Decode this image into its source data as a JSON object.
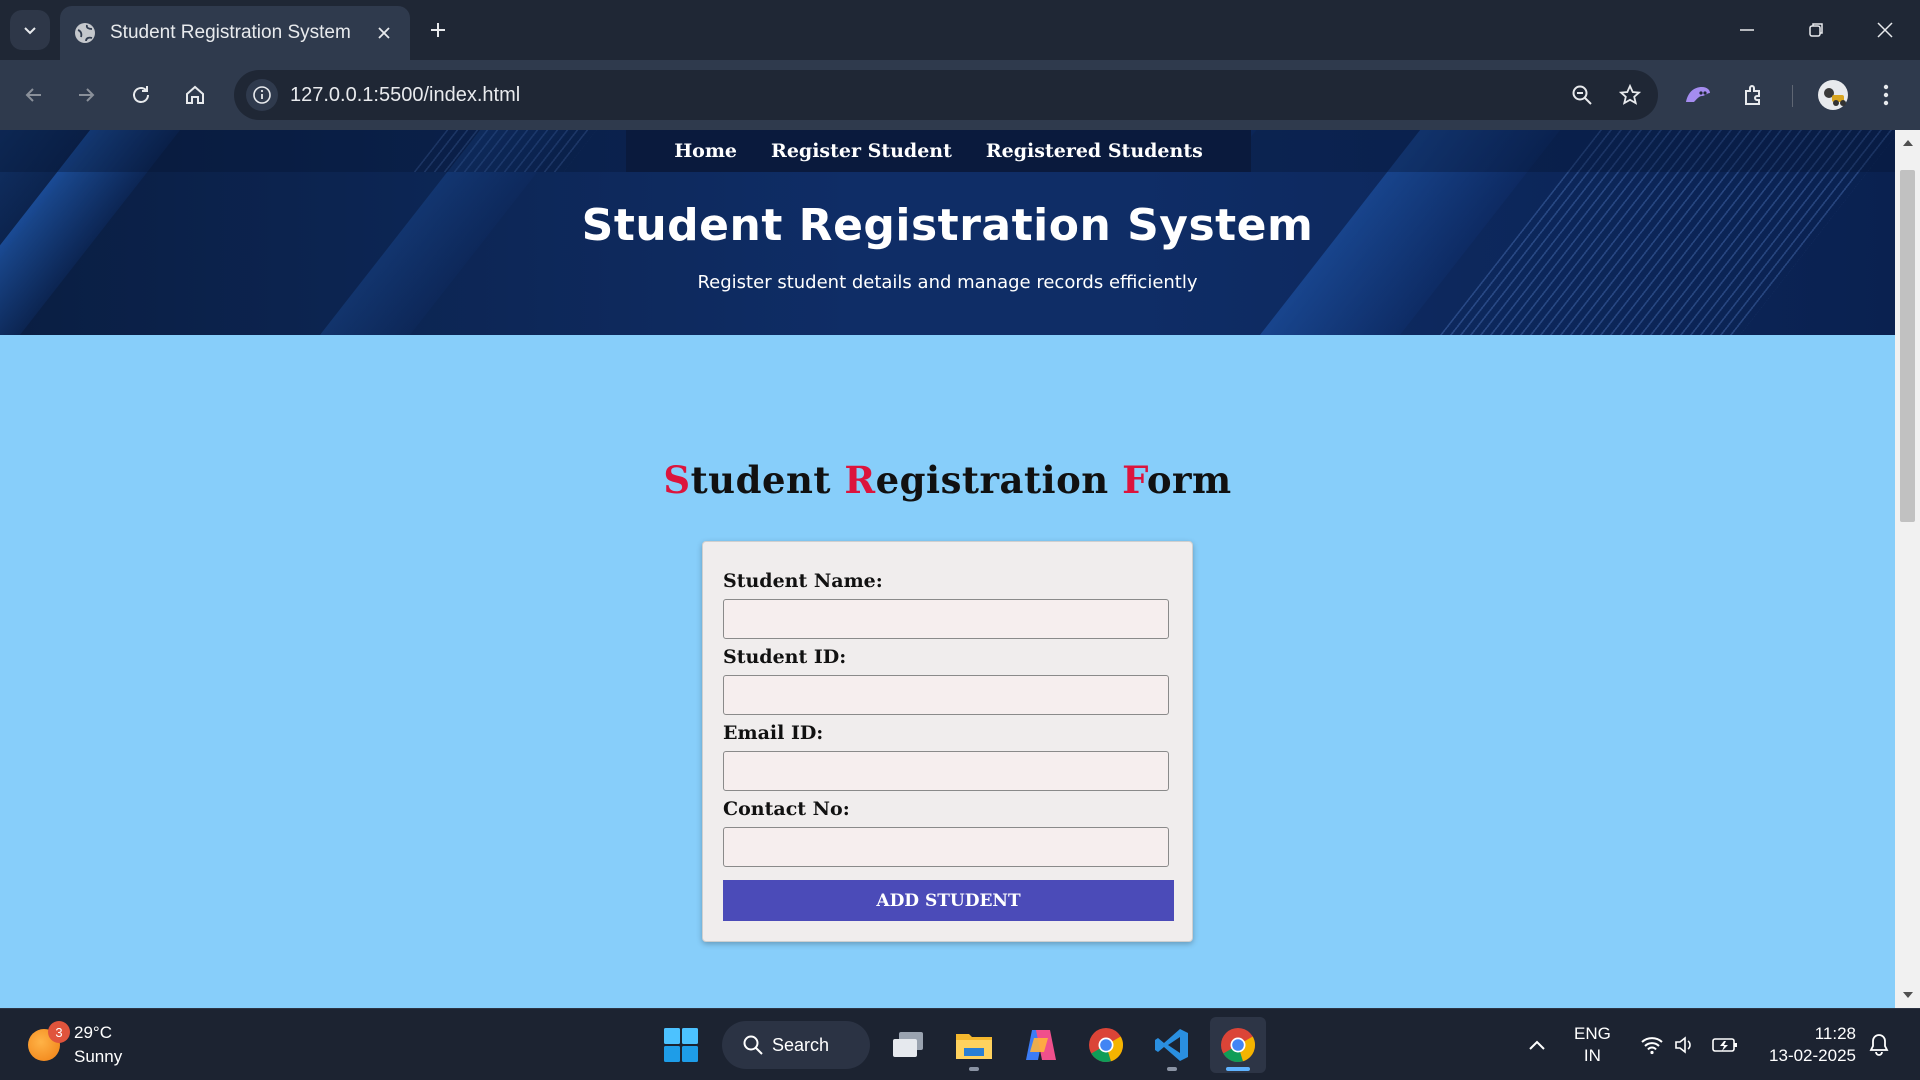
{
  "browser": {
    "tab_title": "Student Registration System",
    "url": "127.0.0.1:5500/index.html"
  },
  "page": {
    "nav": {
      "home": "Home",
      "register": "Register Student",
      "registered": "Registered Students"
    },
    "hero": {
      "title": "Student Registration System",
      "subtitle": "Register student details and manage records efficiently"
    },
    "form": {
      "heading_parts": [
        {
          "cap": "S",
          "rest": "tudent "
        },
        {
          "cap": "R",
          "rest": "egistration "
        },
        {
          "cap": "F",
          "rest": "orm"
        }
      ],
      "fields": {
        "name_label": "Student Name:",
        "id_label": "Student ID:",
        "email_label": "Email ID:",
        "contact_label": "Contact No:"
      },
      "values": {
        "name": "",
        "id": "",
        "email": "",
        "contact": ""
      },
      "submit_label": "ADD STUDENT"
    },
    "colors": {
      "page_bg": "#87cefa",
      "accent_letter": "#dc143c",
      "button_bg": "#4b4bb8",
      "hero_bg": "#0f2d66"
    }
  },
  "taskbar": {
    "weather": {
      "badge": "3",
      "temp": "29°C",
      "condition": "Sunny"
    },
    "search_label": "Search",
    "language": {
      "line1": "ENG",
      "line2": "IN"
    },
    "clock": {
      "time": "11:28",
      "date": "13-02-2025"
    },
    "apps": [
      "windows-start-icon",
      "task-view-icon",
      "file-explorer-icon",
      "copilot-icon",
      "chrome-icon",
      "vscode-icon",
      "chrome-active-icon"
    ]
  }
}
